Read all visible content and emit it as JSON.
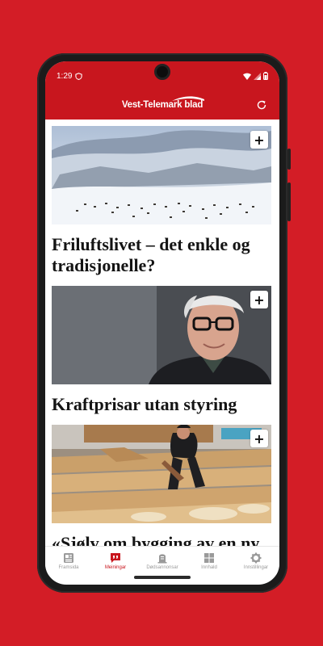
{
  "status": {
    "time": "1:29"
  },
  "app": {
    "logo_text": "Vest-Telemark blad"
  },
  "articles": [
    {
      "title": "Friluftslivet – det enkle og tradisjonelle?",
      "image": "snowy-mountain-reindeer-photo"
    },
    {
      "title": "Kraftprisar utan styring",
      "image": "portrait-man-glasses-photo"
    },
    {
      "title": "«Sjølv om bygging av en ny",
      "image": "carpenter-timber-workshop-photo"
    }
  ],
  "nav": {
    "items": [
      {
        "label": "Framsida",
        "icon": "newspaper-icon",
        "active": false
      },
      {
        "label": "Meiningar",
        "icon": "quote-bubble-icon",
        "active": true
      },
      {
        "label": "Dødsannonsar",
        "icon": "tombstone-icon",
        "active": false
      },
      {
        "label": "Innhald",
        "icon": "grid-icon",
        "active": false
      },
      {
        "label": "Innstillingar",
        "icon": "gear-icon",
        "active": false
      }
    ]
  },
  "colors": {
    "brand_red": "#c8161e",
    "background_red": "#d31d26"
  }
}
